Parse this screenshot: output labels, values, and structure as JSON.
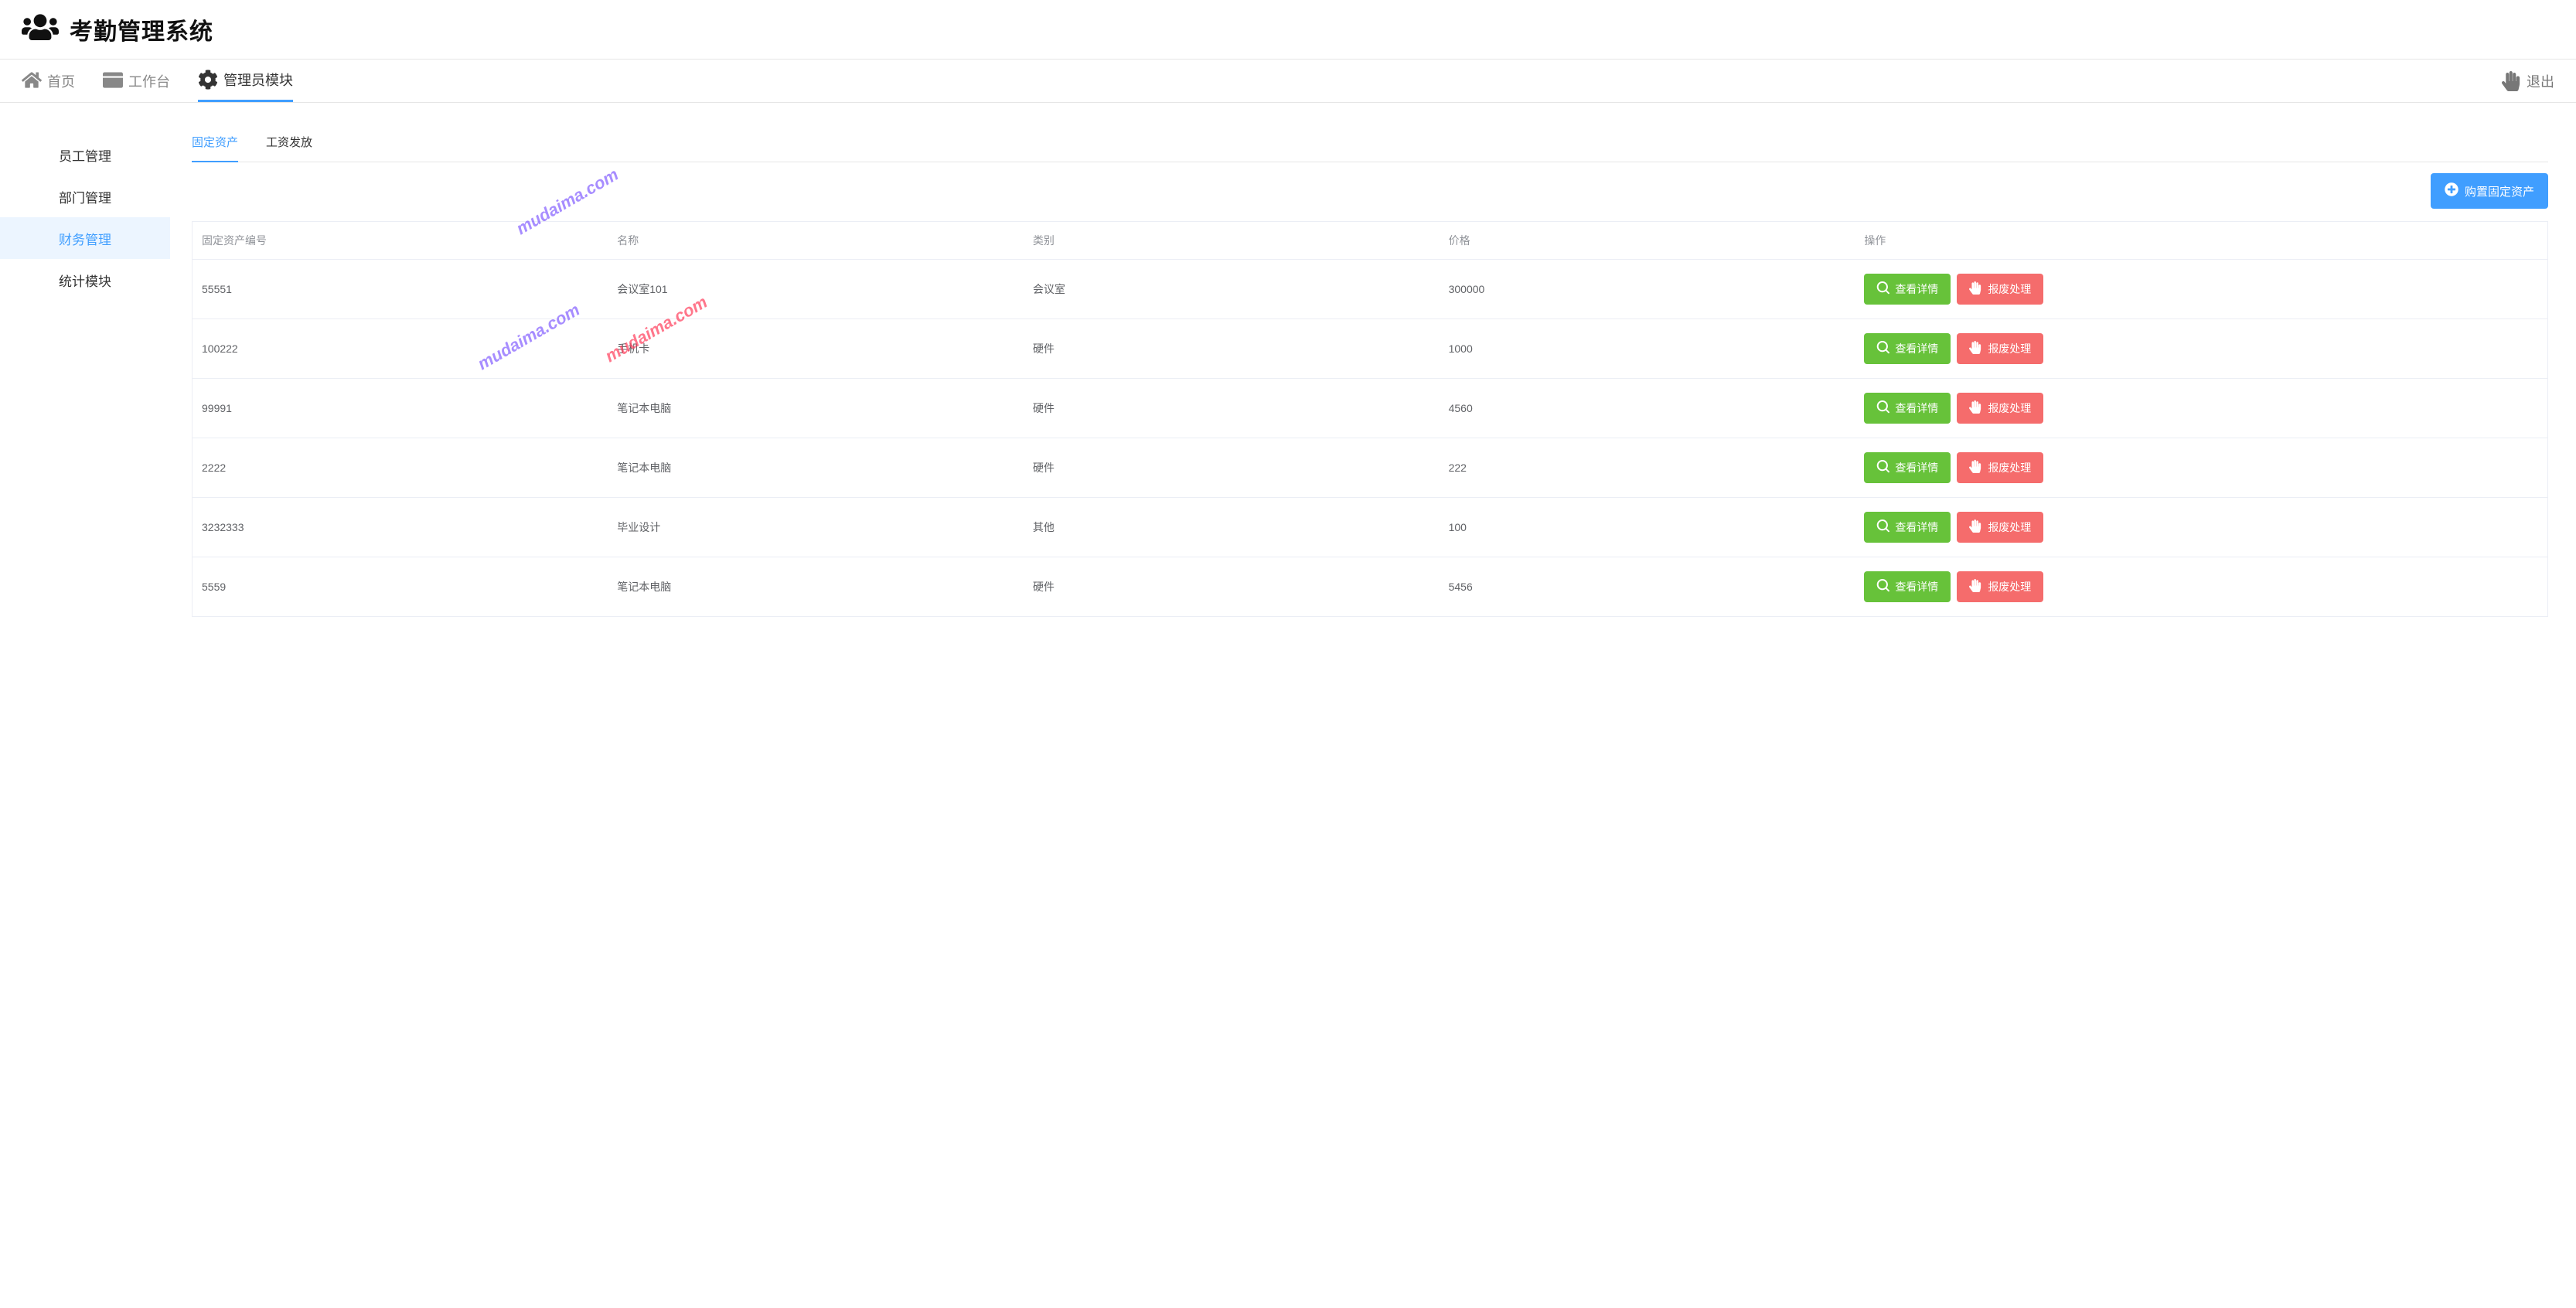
{
  "header": {
    "title": "考勤管理系统"
  },
  "topnav": {
    "items": [
      {
        "icon": "home",
        "label": "首页"
      },
      {
        "icon": "workbench",
        "label": "工作台"
      },
      {
        "icon": "gear",
        "label": "管理员模块"
      }
    ],
    "logout": "退出"
  },
  "sidebar": {
    "items": [
      {
        "label": "员工管理"
      },
      {
        "label": "部门管理"
      },
      {
        "label": "财务管理"
      },
      {
        "label": "统计模块"
      }
    ],
    "activeIndex": 2
  },
  "tabs": {
    "items": [
      {
        "label": "固定资产"
      },
      {
        "label": "工资发放"
      }
    ],
    "activeIndex": 0
  },
  "actions": {
    "add_asset_label": "购置固定资产",
    "view_label": "查看详情",
    "scrap_label": "报废处理"
  },
  "table": {
    "columns": [
      "固定资产编号",
      "名称",
      "类别",
      "价格",
      "操作"
    ],
    "rows": [
      {
        "id": "55551",
        "name": "会议室101",
        "category": "会议室",
        "price": "300000"
      },
      {
        "id": "100222",
        "name": "手机卡",
        "category": "硬件",
        "price": "1000"
      },
      {
        "id": "99991",
        "name": "笔记本电脑",
        "category": "硬件",
        "price": "4560"
      },
      {
        "id": "2222",
        "name": "笔记本电脑",
        "category": "硬件",
        "price": "222"
      },
      {
        "id": "3232333",
        "name": "毕业设计",
        "category": "其他",
        "price": "100"
      },
      {
        "id": "5559",
        "name": "笔记本电脑",
        "category": "硬件",
        "price": "5456"
      }
    ]
  },
  "watermark": "mudaima.com"
}
